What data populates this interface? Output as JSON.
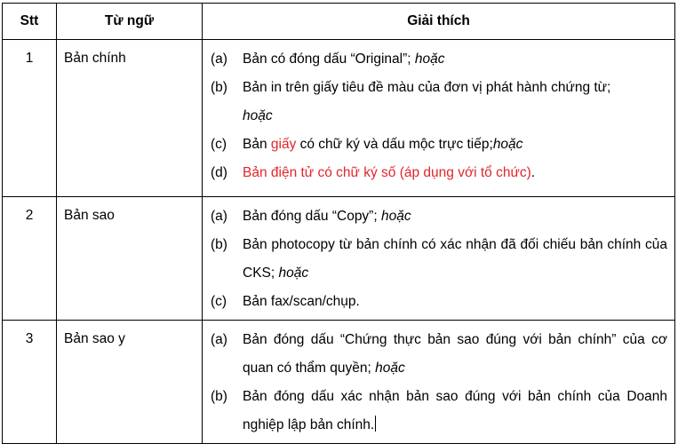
{
  "header": {
    "stt": "Stt",
    "term": "Từ ngữ",
    "explanation": "Giải thích"
  },
  "rows": [
    {
      "stt": "1",
      "term": "Bản chính",
      "items": [
        {
          "mark": "(a)",
          "text": "Bản có đóng dấu “Original”; ",
          "em": "hoặc"
        },
        {
          "mark": "(b)",
          "text": "Bản in trên giấy tiêu đề màu của đơn vị phát hành chứng từ;",
          "em": "hoặc"
        },
        {
          "mark": "(c)",
          "pre": "Bản ",
          "red": "giấy",
          "post": " có chữ ký và dấu mộc trực tiếp;",
          "em": "hoặc"
        },
        {
          "mark": "(d)",
          "red": "Bản điện tử có chữ ký số (áp dụng với tổ chức)",
          "post": "."
        }
      ]
    },
    {
      "stt": "2",
      "term": "Bản sao",
      "items": [
        {
          "mark": "(a)",
          "text": "Bản đóng dấu “Copy”; ",
          "em": "hoặc"
        },
        {
          "mark": "(b)",
          "text": "Bản photocopy từ bản chính có xác nhận đã đối chiếu bản chính của CKS; ",
          "em": "hoặc"
        },
        {
          "mark": "(c)",
          "text": "Bản fax/scan/chụp."
        }
      ]
    },
    {
      "stt": "3",
      "term": "Bản sao y",
      "items": [
        {
          "mark": "(a)",
          "text": "Bản đóng dấu “Chứng thực bản sao đúng với bản chính” của cơ quan có thẩm quyền; ",
          "em": "hoặc"
        },
        {
          "mark": "(b)",
          "text": "Bản đóng dấu xác nhận bản sao đúng với bản chính của Doanh nghiệp lập bản chính."
        }
      ]
    }
  ]
}
